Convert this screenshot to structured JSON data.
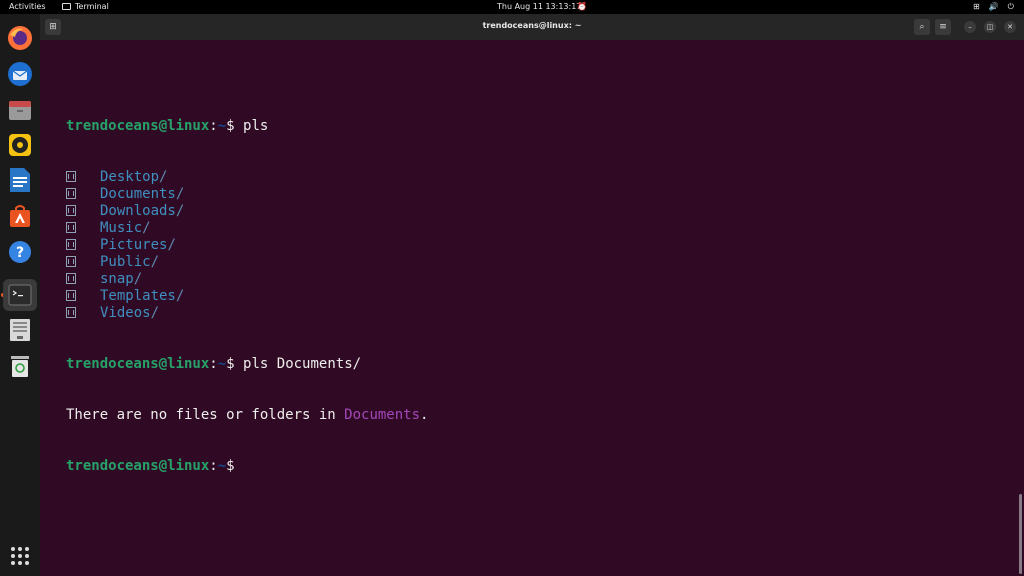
{
  "topbar": {
    "activities": "Activities",
    "app_name": "Terminal",
    "clock": "Thu Aug 11  13:13:17",
    "icons": [
      "alarm-icon",
      "network-icon",
      "volume-icon",
      "power-icon"
    ]
  },
  "dock": {
    "apps": [
      "firefox",
      "thunderbird",
      "files",
      "rhythmbox",
      "libreoffice-writer",
      "app-center",
      "help",
      "terminal",
      "save-device",
      "trash"
    ],
    "active": "terminal"
  },
  "window": {
    "title": "trendoceans@linux: ~"
  },
  "terminal": {
    "prompt_user": "trendoceans@linux",
    "prompt_path": "~",
    "prompt_symbol": "$",
    "command1": "pls",
    "listing": [
      "Desktop",
      "Documents",
      "Downloads",
      "Music",
      "Pictures",
      "Public",
      "snap",
      "Templates",
      "Videos"
    ],
    "slash": "/",
    "command2": "pls Documents/",
    "message_prefix": "There are no files or folders in ",
    "message_folder": "Documents",
    "message_suffix": "."
  },
  "colors": {
    "background": "#300a24",
    "prompt_user": "#26a269",
    "directory": "#3f8fc0",
    "highlight": "#a347ba"
  }
}
